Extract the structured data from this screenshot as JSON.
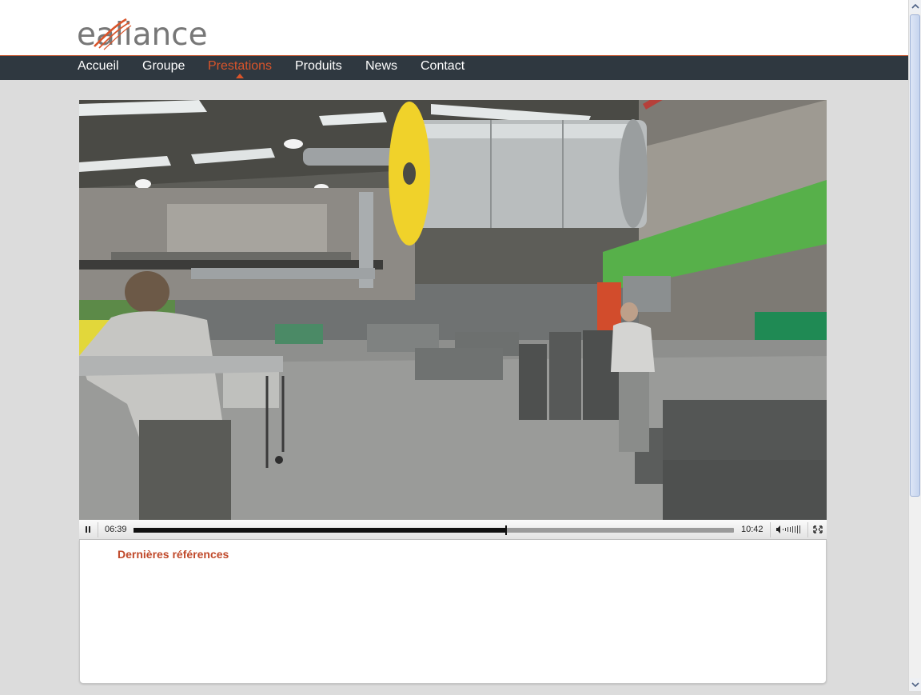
{
  "brand": {
    "logo_text": "ealiance"
  },
  "nav": {
    "items": [
      {
        "label": "Accueil"
      },
      {
        "label": "Groupe"
      },
      {
        "label": "Prestations"
      },
      {
        "label": "Produits"
      },
      {
        "label": "News"
      },
      {
        "label": "Contact"
      }
    ],
    "active_item": "Prestations"
  },
  "video": {
    "current_time": "06:39",
    "duration": "10:42",
    "progress": 0.621,
    "playing": true
  },
  "content": {
    "section_title": "Dernières références"
  },
  "colors": {
    "accent": "#d9542a",
    "nav_bg": "#2f3840",
    "page_bg": "#dcdcdc"
  }
}
